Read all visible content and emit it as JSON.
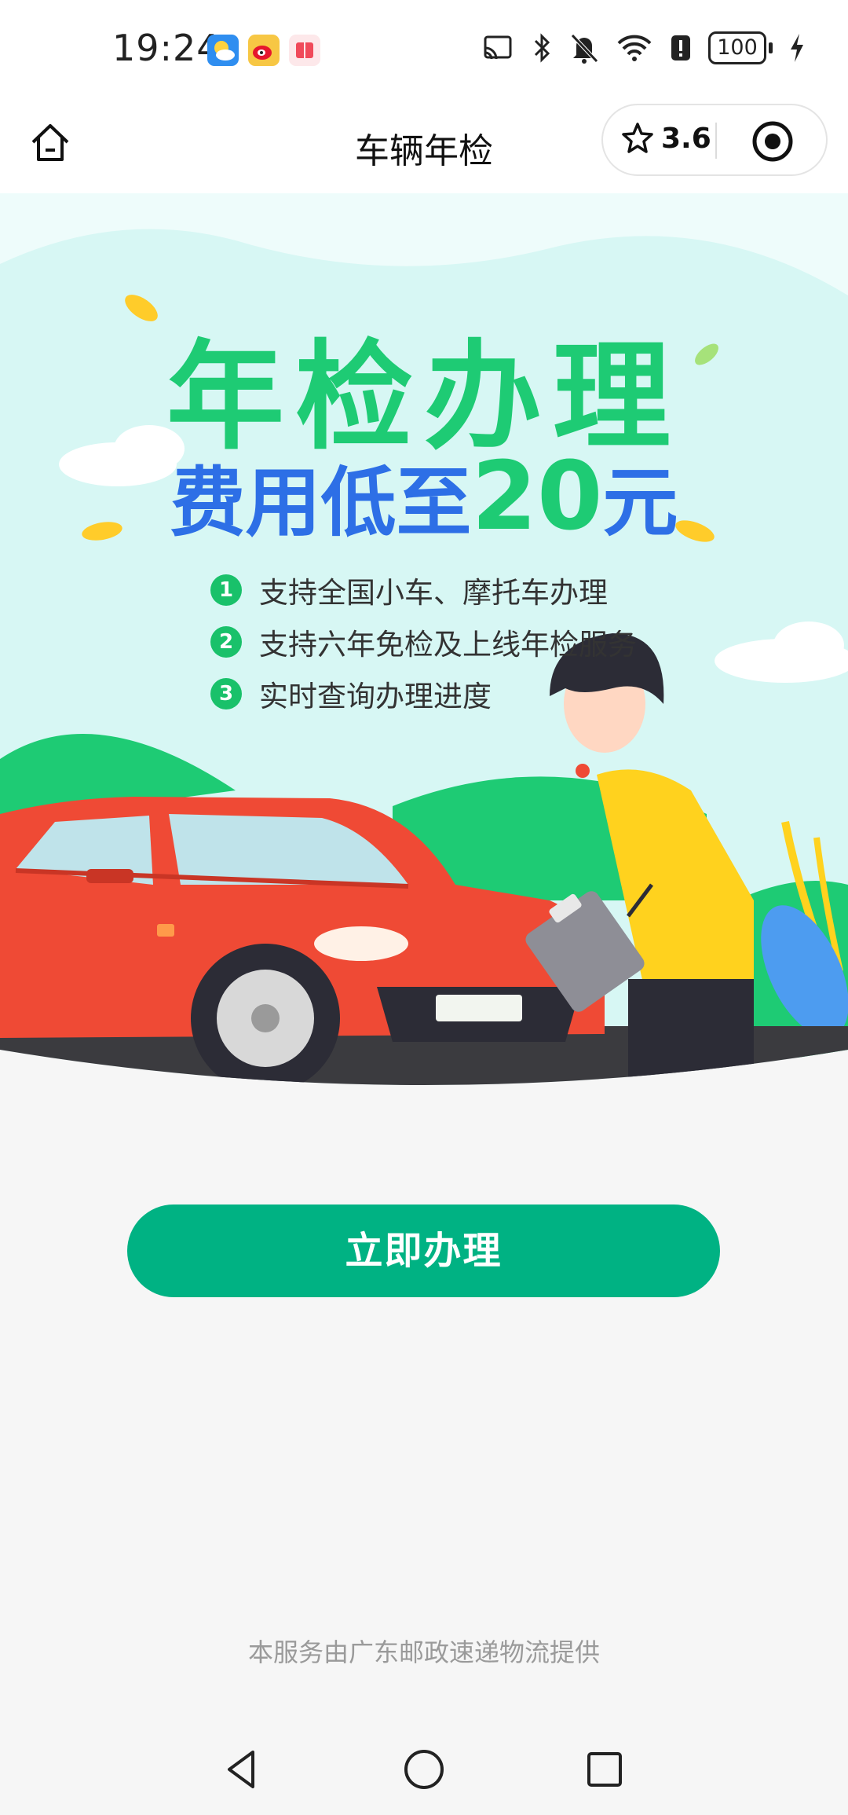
{
  "status_bar": {
    "time": "19:24",
    "battery": "100",
    "notification_icons": [
      "weather-app-icon",
      "weibo-app-icon",
      "reader-app-icon"
    ],
    "system_icons": [
      "cast-icon",
      "bluetooth-icon",
      "mute-bell-icon",
      "wifi-icon",
      "alert-icon",
      "battery-icon",
      "charging-icon"
    ]
  },
  "nav": {
    "title": "车辆年检",
    "rating": "3.6",
    "home_icon": "home-icon",
    "rating_icon": "star-icon",
    "more_icon": "record-target-icon"
  },
  "hero": {
    "title": "年检办理",
    "subtitle_pre": "费用低至",
    "subtitle_price": "20",
    "subtitle_unit": "元",
    "features": [
      {
        "num": "1",
        "text": "支持全国小车、摩托车办理"
      },
      {
        "num": "2",
        "text": "支持六年免检及上线年检服务"
      },
      {
        "num": "3",
        "text": "实时查询办理进度"
      }
    ]
  },
  "cta": {
    "label": "立即办理"
  },
  "footer": {
    "note": "本服务由广东邮政速递物流提供"
  },
  "colors": {
    "accent_green": "#00b283",
    "title_green": "#1ecb74",
    "subtitle_blue": "#2d6fe6",
    "car_red": "#ef4a35",
    "shirt_yellow": "#ffd21e"
  },
  "system_nav": [
    "back-icon",
    "home-circle-icon",
    "recents-icon"
  ]
}
